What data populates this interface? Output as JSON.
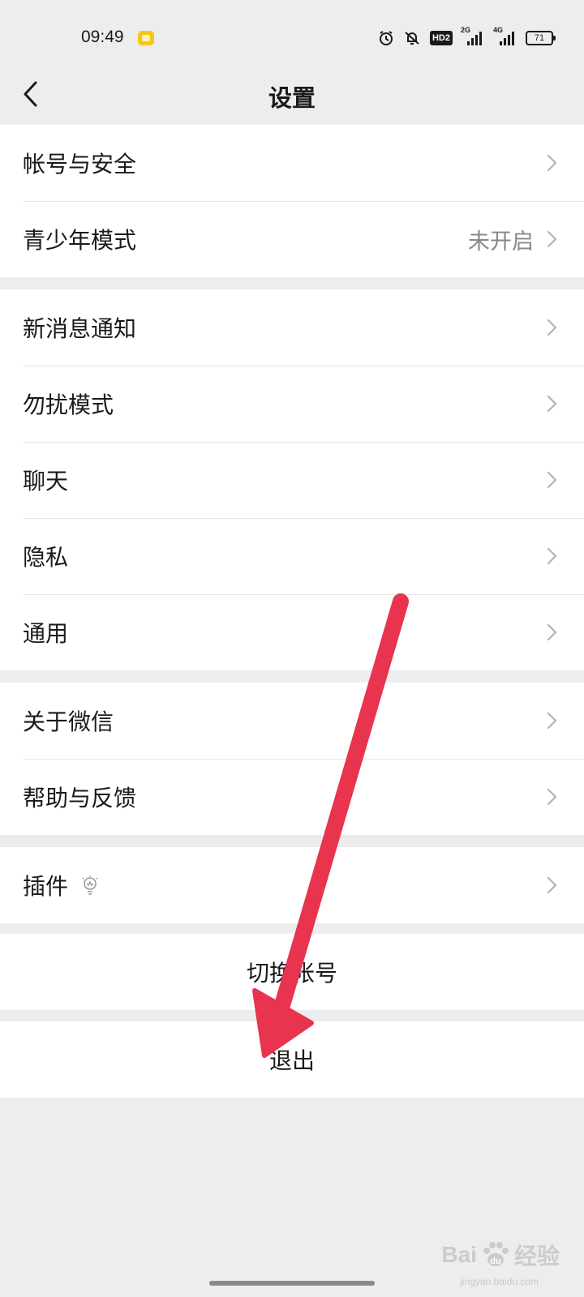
{
  "status_bar": {
    "time": "09:49",
    "hd": "HD2",
    "net1": "2G",
    "net2": "4G",
    "battery": "71"
  },
  "header": {
    "title": "设置"
  },
  "groups": {
    "account": {
      "account_security": "帐号与安全",
      "teen_mode": "青少年模式",
      "teen_mode_value": "未开启"
    },
    "notifications": {
      "new_message": "新消息通知",
      "dnd_mode": "勿扰模式",
      "chat": "聊天",
      "privacy": "隐私",
      "general": "通用"
    },
    "about": {
      "about_wechat": "关于微信",
      "help_feedback": "帮助与反馈"
    },
    "plugins": {
      "label": "插件"
    }
  },
  "actions": {
    "switch_account": "切换帐号",
    "logout": "退出"
  },
  "annotation": {
    "arrow_color": "#e8344e"
  },
  "watermark": {
    "brand": "Bai",
    "brand_tail": "经验",
    "url": "jingyan.baidu.com"
  }
}
